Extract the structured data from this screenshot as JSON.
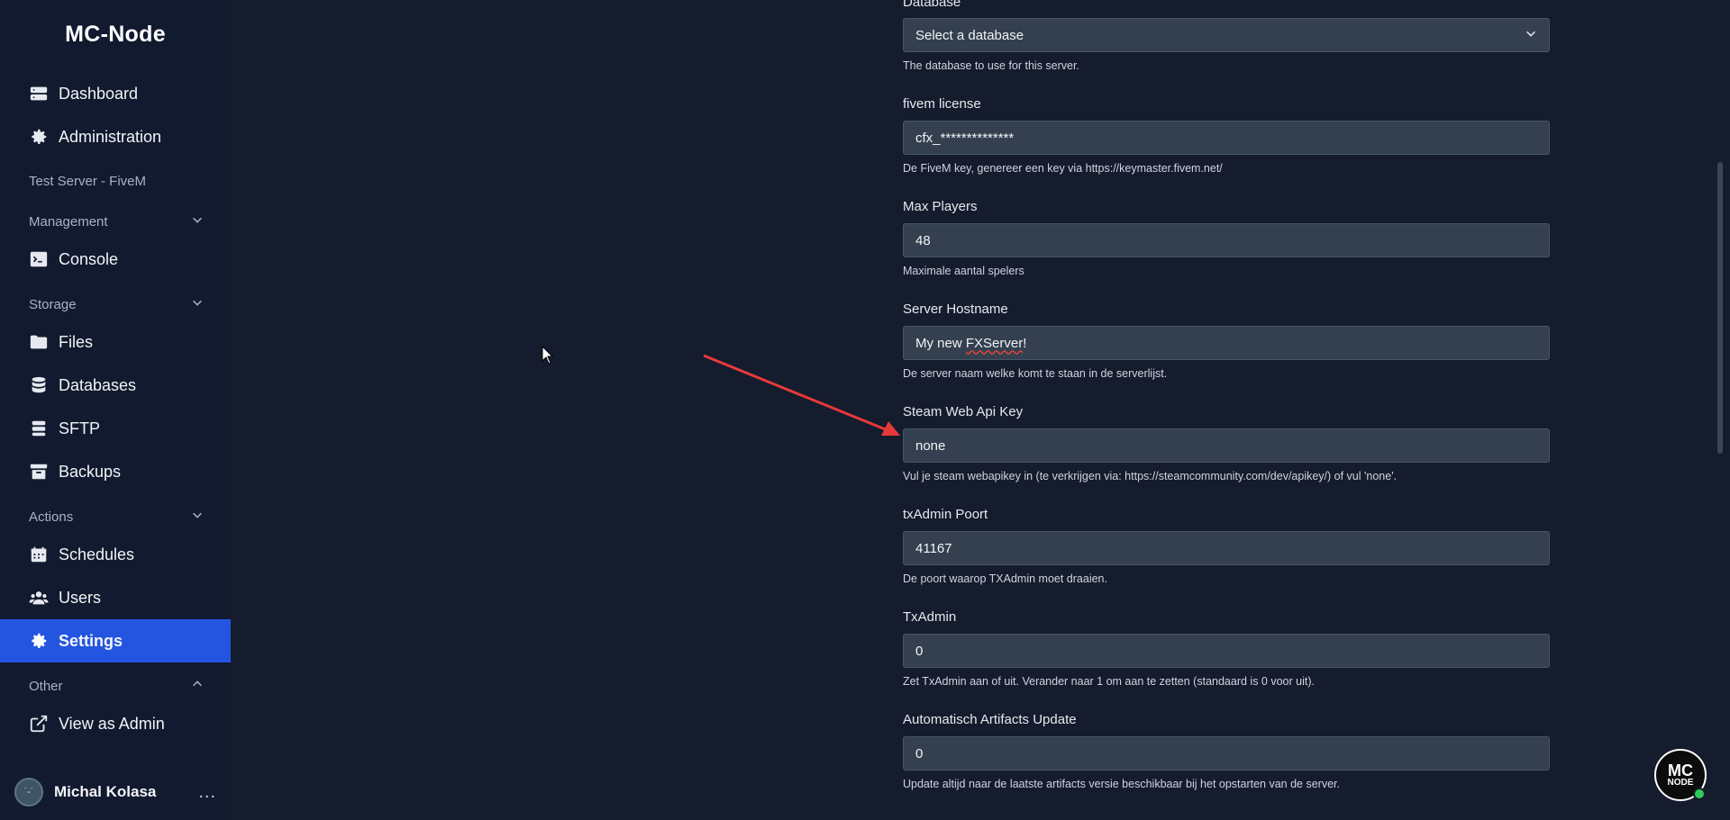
{
  "app": {
    "title": "MC-Node"
  },
  "sidebar": {
    "top_items": [
      {
        "label": "Dashboard",
        "icon": "server-stack-icon"
      },
      {
        "label": "Administration",
        "icon": "gear-icon"
      }
    ],
    "server_name": "Test Server - FiveM",
    "sections": {
      "management": {
        "label": "Management",
        "items": [
          {
            "label": "Console",
            "icon": "terminal-icon"
          }
        ]
      },
      "storage": {
        "label": "Storage",
        "items": [
          {
            "label": "Files",
            "icon": "folder-icon"
          },
          {
            "label": "Databases",
            "icon": "database-icon"
          },
          {
            "label": "SFTP",
            "icon": "database-stack-icon"
          },
          {
            "label": "Backups",
            "icon": "archive-icon"
          }
        ]
      },
      "actions": {
        "label": "Actions",
        "items": [
          {
            "label": "Schedules",
            "icon": "calendar-icon"
          },
          {
            "label": "Users",
            "icon": "users-icon"
          },
          {
            "label": "Settings",
            "icon": "gear-icon",
            "active": true
          }
        ]
      },
      "other": {
        "label": "Other",
        "items": [
          {
            "label": "View as Admin",
            "icon": "external-link-icon"
          }
        ]
      }
    },
    "user": {
      "name": "Michal Kolasa",
      "menu": "..."
    }
  },
  "form": {
    "database": {
      "label": "Database",
      "value": "Select a database",
      "hint": "The database to use for this server."
    },
    "fivem_license": {
      "label": "fivem license",
      "value": "cfx_**************",
      "hint": "De FiveM key, genereer een key via https://keymaster.fivem.net/"
    },
    "max_players": {
      "label": "Max Players",
      "value": "48",
      "hint": "Maximale aantal spelers"
    },
    "server_hostname": {
      "label": "Server Hostname",
      "value_prefix": "My new ",
      "value_underlined": "FXServer",
      "value_suffix": "!",
      "hint": "De server naam welke komt te staan in de serverlijst."
    },
    "steam_web_api_key": {
      "label": "Steam Web Api Key",
      "value": "none",
      "hint": "Vul je steam webapikey in (te verkrijgen via: https://steamcommunity.com/dev/apikey/) of vul 'none'."
    },
    "txadmin_port": {
      "label": "txAdmin Poort",
      "value": "41167",
      "hint": "De poort waarop TXAdmin moet draaien."
    },
    "txadmin": {
      "label": "TxAdmin",
      "value": "0",
      "hint": "Zet TxAdmin aan of uit. Verander naar 1 om aan te zetten (standaard is 0 voor uit)."
    },
    "auto_artifacts": {
      "label": "Automatisch Artifacts Update",
      "value": "0",
      "hint": "Update altijd naar de laatste artifacts versie beschikbaar bij het opstarten van de server."
    }
  },
  "badge": {
    "line1": "MC",
    "line2": "NODE",
    "status_color": "#2ecc57"
  },
  "colors": {
    "accent": "#2455e0",
    "annotation_arrow": "#e8393a"
  }
}
